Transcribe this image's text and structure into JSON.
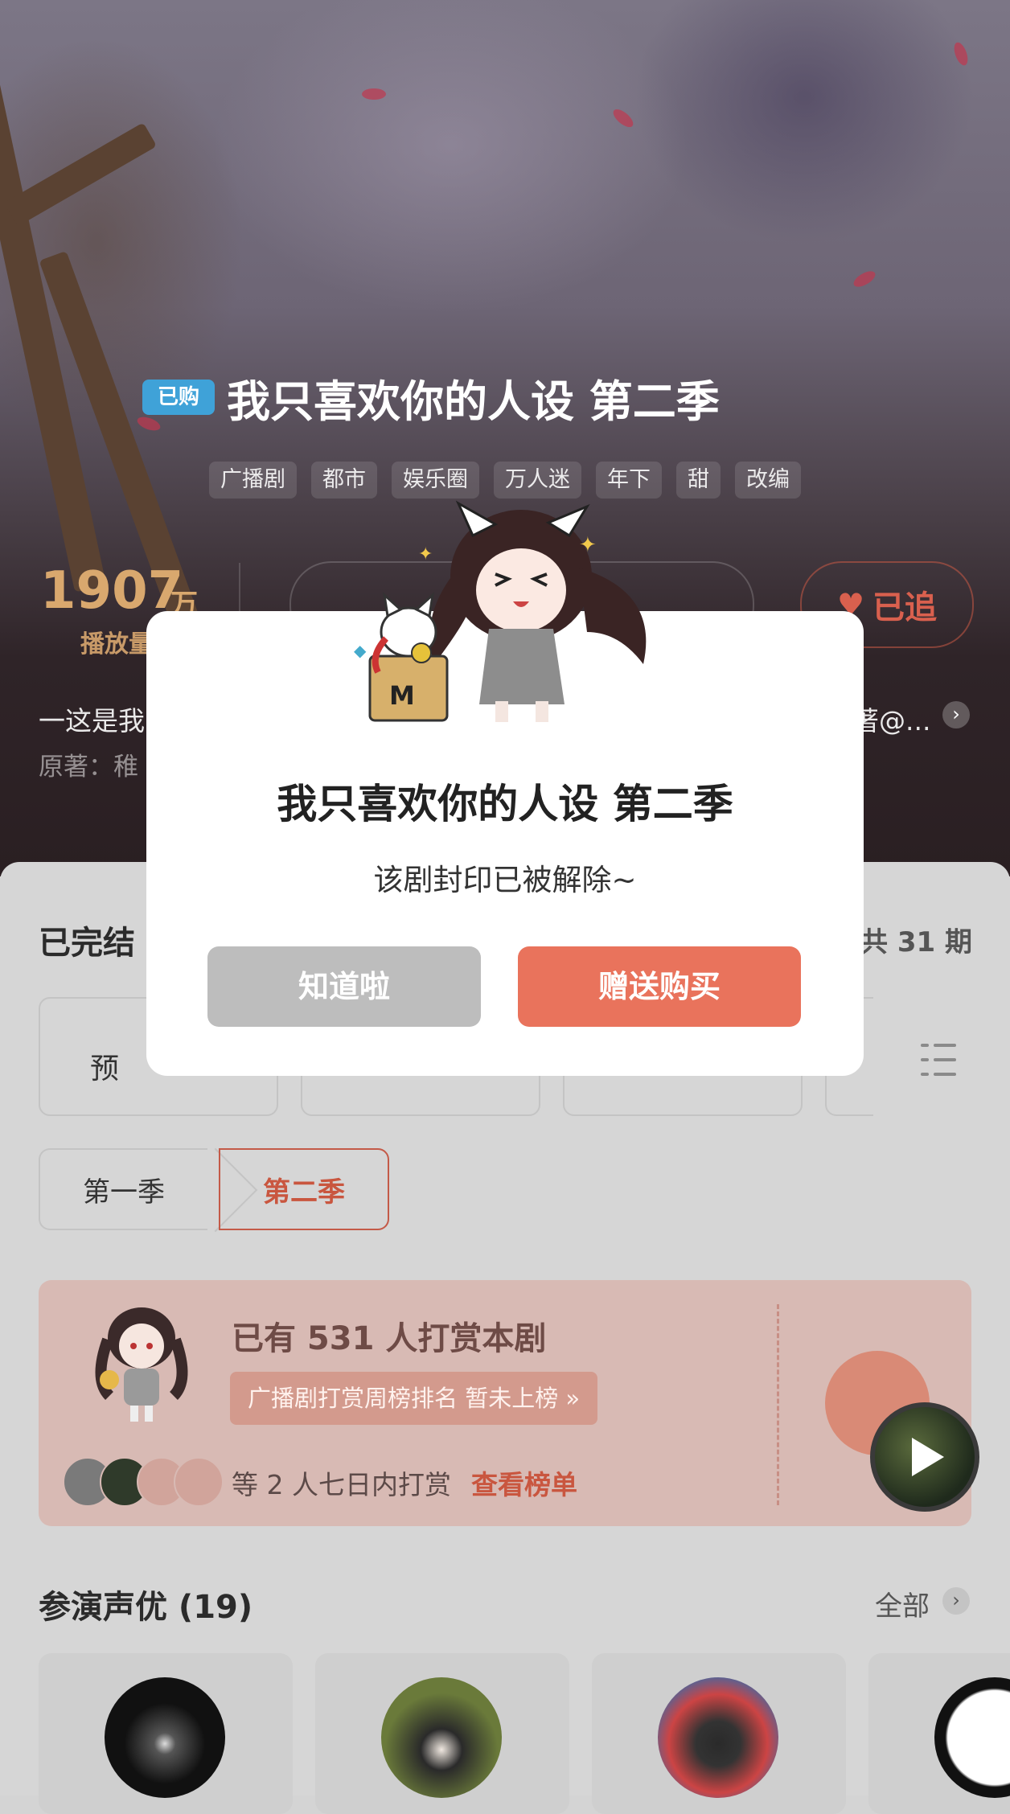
{
  "hero": {
    "bought_badge": "已购",
    "title": "我只喜欢你的人设 第二季",
    "tags": [
      "广播剧",
      "都市",
      "娱乐圈",
      "万人迷",
      "年下",
      "甜",
      "改编"
    ],
    "play_count": "1907",
    "play_count_unit": "万",
    "play_count_label": "播放量",
    "follow_label": "已追",
    "intro_text": "一这是我",
    "intro_tail": "著@...",
    "original_author": "原著：稚"
  },
  "episodes": {
    "status": "已完结",
    "total": "共 31 期",
    "first_card_label": "预"
  },
  "seasons": [
    "第一季",
    "第二季"
  ],
  "reward": {
    "title": "已有 531 人打赏本剧",
    "rank_text": "广播剧打赏周榜排名 暂未上榜 »",
    "recent_text": "等 2 人七日内打赏",
    "view_list": "查看榜单"
  },
  "cast": {
    "title": "参演声优 (19)",
    "all_label": "全部"
  },
  "dialog": {
    "title": "我只喜欢你的人设 第二季",
    "message": "该剧封印已被解除~",
    "ok_label": "知道啦",
    "buy_label": "赠送购买"
  },
  "colors": {
    "accent": "#e9735c",
    "bought_badge": "#3fa2d8",
    "play_count": "#d9a86e"
  }
}
